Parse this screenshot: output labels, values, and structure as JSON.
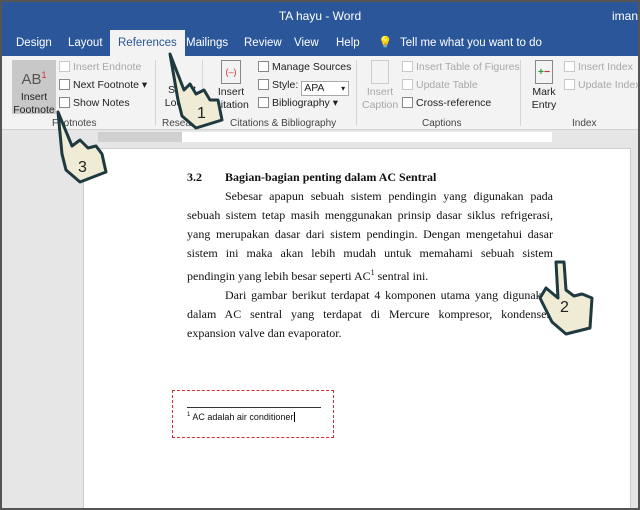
{
  "window": {
    "title": "TA hayu  -  Word",
    "user": "iman"
  },
  "tabs": [
    {
      "label": "Design"
    },
    {
      "label": "Layout"
    },
    {
      "label": "References",
      "active": true
    },
    {
      "label": "Mailings"
    },
    {
      "label": "Review"
    },
    {
      "label": "View"
    },
    {
      "label": "Help"
    }
  ],
  "tell_me": "Tell me what you want to do",
  "ribbon": {
    "footnotes": {
      "insert_footnote": "Insert Footnote",
      "insert_endnote": "Insert Endnote",
      "next_footnote": "Next Footnote",
      "show_notes": "Show Notes",
      "group": "Footnotes"
    },
    "research": {
      "smart_lookup": "Smart Lookup",
      "group": "Research"
    },
    "citations": {
      "insert_citation": "Insert Citation",
      "manage_sources": "Manage Sources",
      "style_label": "Style:",
      "style_value": "APA",
      "bibliography": "Bibliography",
      "group": "Citations & Bibliography"
    },
    "captions": {
      "insert_caption": "Insert Caption",
      "insert_table_of_figures": "Insert Table of Figures",
      "update_table": "Update Table",
      "cross_reference": "Cross-reference",
      "group": "Captions"
    },
    "index": {
      "mark_entry": "Mark Entry",
      "insert_index": "Insert Index",
      "update_index": "Update Index",
      "group": "Index"
    }
  },
  "document": {
    "heading_num": "3.2",
    "heading": "Bagian-bagian penting dalam AC Sentral",
    "p1": "Sebesar apapun sebuah sistem pendingin yang digunakan pada sebuah sistem tetap masih menggunakan prinsip dasar siklus refrigerasi, yang merupakan dasar dari sistem pendingin. Dengan mengetahui dasar sistem ini maka akan lebih mudah untuk memahami sebuah sistem pendingin yang lebih besar seperti AC",
    "p1_sup": "1",
    "p1_end": " sentral ini.",
    "p2": "Dari gambar berikut terdapat 4 komponen utama yang digunakan dalam AC sentral yang terdapat di Mercure kompresor, kondenser, expansion valve dan evaporator.",
    "footnote_num": "1",
    "footnote": " AC adalah air conditioner"
  },
  "annotations": [
    {
      "step": "1"
    },
    {
      "step": "2"
    },
    {
      "step": "3"
    }
  ],
  "colors": {
    "titlebar": "#2b579a",
    "footnote_box": "#d03030",
    "hand_fill": "#f0ebd5"
  }
}
